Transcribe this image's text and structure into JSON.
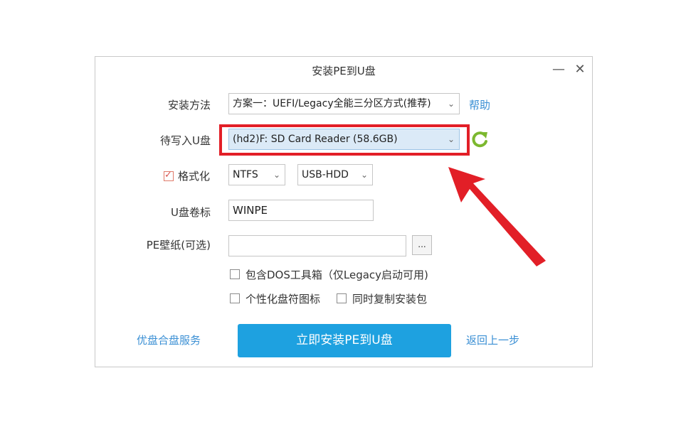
{
  "window": {
    "title": "安装PE到U盘",
    "minimize_label": "—",
    "close_label": "✕"
  },
  "install_method": {
    "label": "安装方法",
    "value": "方案一：UEFI/Legacy全能三分区方式(推荐)",
    "help_link": "帮助"
  },
  "target_drive": {
    "label": "待写入U盘",
    "value": "(hd2)F: SD Card Reader (58.6GB)"
  },
  "format": {
    "label": "格式化",
    "checked": true,
    "filesystem": "NTFS",
    "mode": "USB-HDD"
  },
  "volume_label": {
    "label": "U盘卷标",
    "value": "WINPE"
  },
  "wallpaper": {
    "label": "PE壁纸(可选)",
    "value": "",
    "browse_label": "..."
  },
  "options": {
    "dos_toolbox": {
      "label": "包含DOS工具箱（仅Legacy启动可用)",
      "checked": false
    },
    "personalize_icon": {
      "label": "个性化盘符图标",
      "checked": false
    },
    "copy_installer": {
      "label": "同时复制安装包",
      "checked": false
    }
  },
  "footer": {
    "merge_service_link": "优盘合盘服务",
    "install_button": "立即安装PE到U盘",
    "back_link": "返回上一步"
  },
  "colors": {
    "accent": "#1ea1e0",
    "link": "#3a8fd4",
    "annotation": "#e21f27",
    "refresh": "#7cb82f"
  }
}
